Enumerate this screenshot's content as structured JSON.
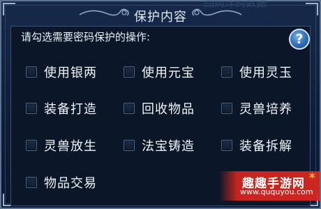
{
  "dialog": {
    "title": "保护内容",
    "background_text": "回购洋购数据",
    "instruction": "请勾选需要密码保护的操作:",
    "help_label": "?"
  },
  "options": [
    {
      "label": "使用银两",
      "checked": false
    },
    {
      "label": "使用元宝",
      "checked": false
    },
    {
      "label": "使用灵玉",
      "checked": false
    },
    {
      "label": "装备打造",
      "checked": false
    },
    {
      "label": "回收物品",
      "checked": false
    },
    {
      "label": "灵兽培养",
      "checked": false
    },
    {
      "label": "灵兽放生",
      "checked": false
    },
    {
      "label": "法宝铸造",
      "checked": false
    },
    {
      "label": "装备拆解",
      "checked": false
    },
    {
      "label": "物品交易",
      "checked": false
    }
  ],
  "watermark": {
    "title": "趣趣手游网",
    "url": "www.ququyou.com"
  },
  "colors": {
    "panel_bg": "#0b1628",
    "text": "#f1f4fa",
    "help_button": "#2f6cb4",
    "watermark_red": "#d6261e"
  }
}
